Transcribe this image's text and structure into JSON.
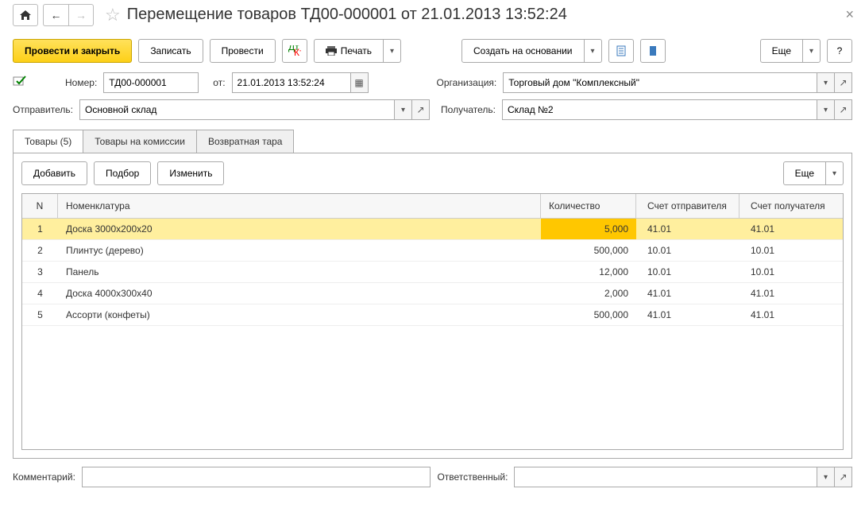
{
  "title": "Перемещение товаров ТД00-000001 от 21.01.2013 13:52:24",
  "toolbar": {
    "post_close": "Провести и закрыть",
    "save": "Записать",
    "post": "Провести",
    "print": "Печать",
    "create_based": "Создать на основании",
    "more": "Еще",
    "help": "?"
  },
  "form": {
    "number_label": "Номер:",
    "number_value": "ТД00-000001",
    "from_label": "от:",
    "date_value": "21.01.2013 13:52:24",
    "org_label": "Организация:",
    "org_value": "Торговый дом \"Комплексный\"",
    "sender_label": "Отправитель:",
    "sender_value": "Основной склад",
    "receiver_label": "Получатель:",
    "receiver_value": "Склад №2"
  },
  "tabs": {
    "goods": "Товары (5)",
    "commission": "Товары на комиссии",
    "return": "Возвратная тара"
  },
  "tab_toolbar": {
    "add": "Добавить",
    "pick": "Подбор",
    "edit": "Изменить",
    "more": "Еще"
  },
  "grid": {
    "headers": {
      "n": "N",
      "nom": "Номенклатура",
      "qty": "Количество",
      "acc_sender": "Счет отправителя",
      "acc_receiver": "Счет получателя"
    },
    "rows": [
      {
        "n": "1",
        "nom": "Доска 3000х200х20",
        "qty": "5,000",
        "acc1": "41.01",
        "acc2": "41.01"
      },
      {
        "n": "2",
        "nom": "Плинтус (дерево)",
        "qty": "500,000",
        "acc1": "10.01",
        "acc2": "10.01"
      },
      {
        "n": "3",
        "nom": "Панель",
        "qty": "12,000",
        "acc1": "10.01",
        "acc2": "10.01"
      },
      {
        "n": "4",
        "nom": "Доска 4000х300х40",
        "qty": "2,000",
        "acc1": "41.01",
        "acc2": "41.01"
      },
      {
        "n": "5",
        "nom": "Ассорти (конфеты)",
        "qty": "500,000",
        "acc1": "41.01",
        "acc2": "41.01"
      }
    ]
  },
  "bottom": {
    "comment_label": "Комментарий:",
    "responsible_label": "Ответственный:"
  }
}
